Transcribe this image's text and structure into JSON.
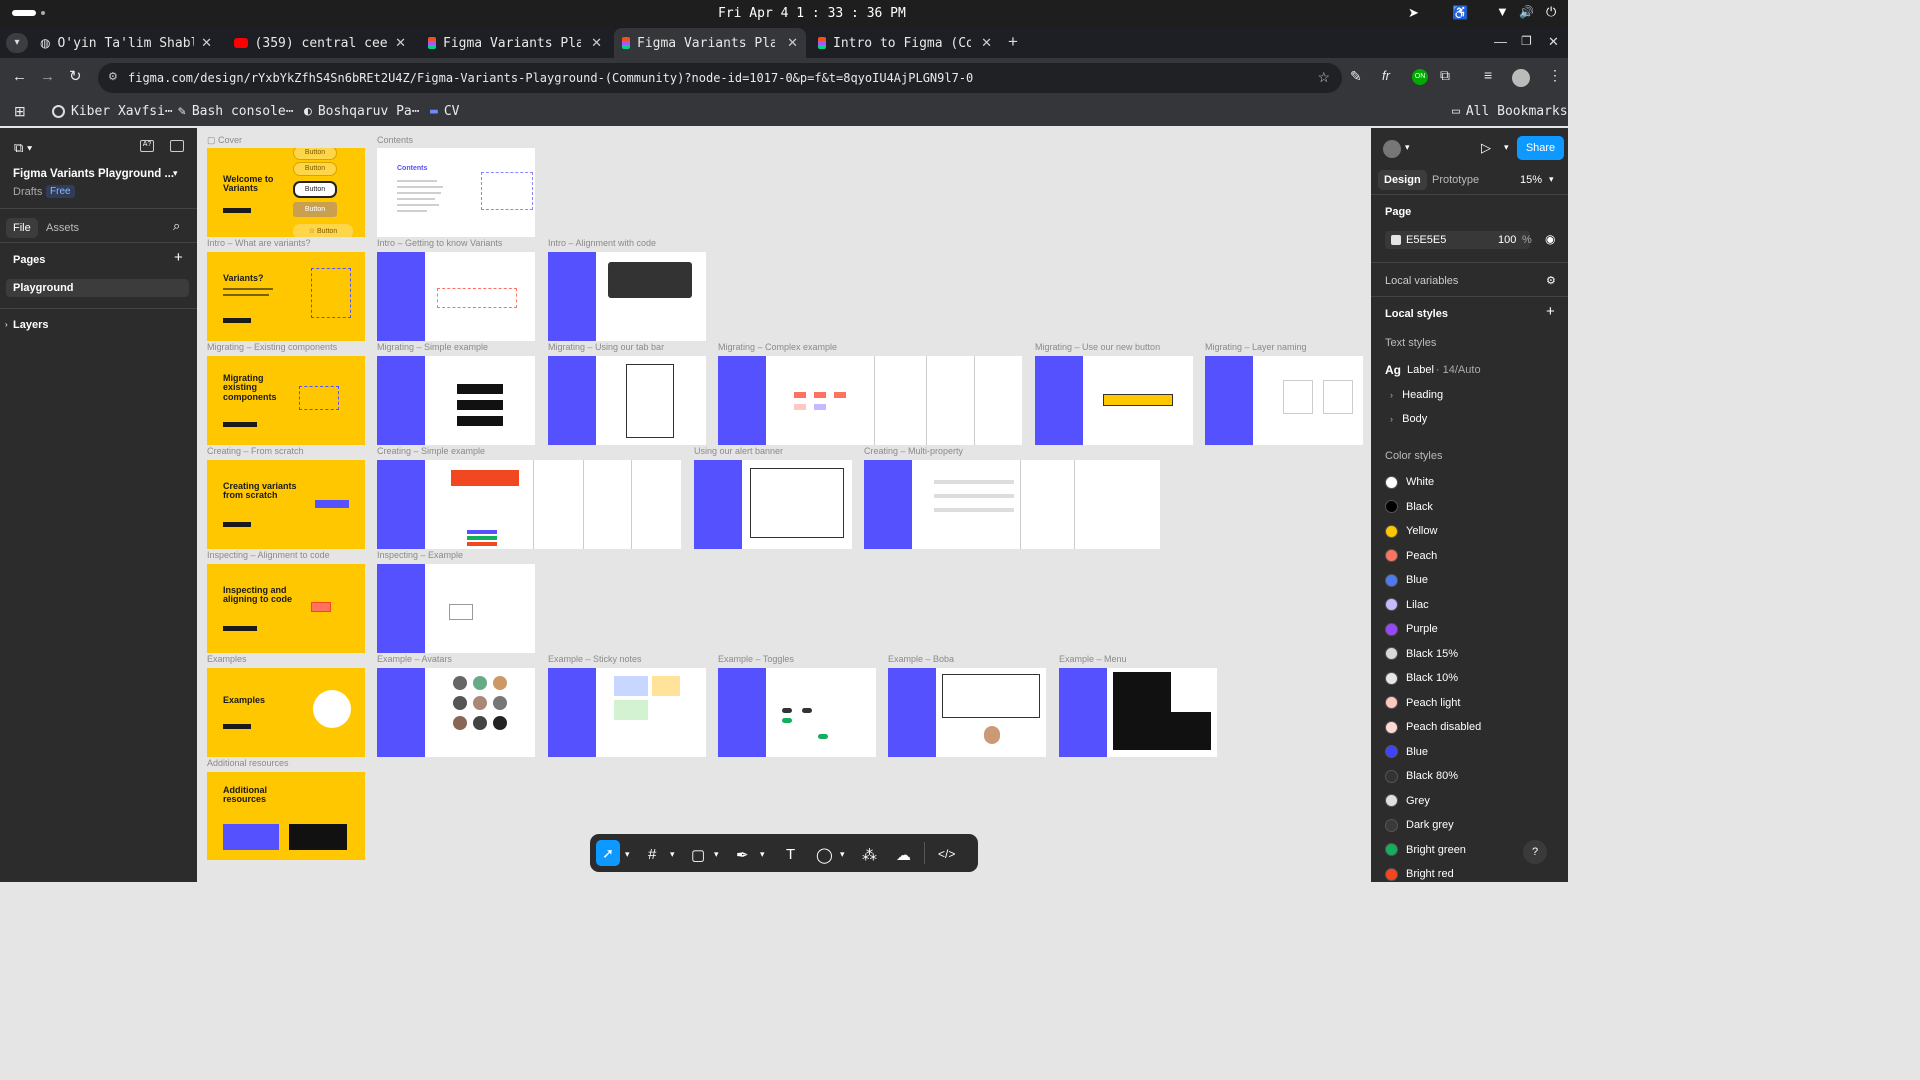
{
  "os": {
    "clock": "Fri Apr 4  1 : 33 : 36 PM"
  },
  "tabs": [
    {
      "label": "O'yin Ta'lim Shablon",
      "icon": "globe-icon"
    },
    {
      "label": "(359) central cee - Y",
      "icon": "youtube-icon"
    },
    {
      "label": "Figma Variants Playgr",
      "icon": "figma-icon"
    },
    {
      "label": "Figma Variants Playgr",
      "icon": "figma-icon"
    },
    {
      "label": "Intro to Figma (Comm",
      "icon": "figma-icon"
    }
  ],
  "address": {
    "url": "figma.com/design/rYxbYkZfhS4Sn6bREt2U4Z/Figma-Variants-Playground-(Community)?node-id=1017-0&p=f&t=8qyoIU4AjPLGN9l7-0"
  },
  "bookmarks": [
    "Kiber Xavfsi⋯",
    "Bash console⋯",
    "Boshqaruv Pa⋯",
    "CV"
  ],
  "all_bookmarks": "All Bookmarks",
  "left": {
    "file_title": "Figma Variants Playground ...",
    "drafts": "Drafts",
    "plan": "Free",
    "tab_file": "File",
    "tab_assets": "Assets",
    "pages_title": "Pages",
    "page_item": "Playground",
    "layers_title": "Layers"
  },
  "right": {
    "share": "Share",
    "tab_design": "Design",
    "tab_prototype": "Prototype",
    "zoom": "15%",
    "page_title": "Page",
    "bg_hex": "E5E5E5",
    "bg_opacity": "100",
    "pct": "%",
    "local_variables": "Local variables",
    "local_styles": "Local styles",
    "text_styles": "Text styles",
    "text_label": "Label",
    "text_label_meta": "· 14/Auto",
    "text_heading": "Heading",
    "text_body": "Body",
    "color_styles": "Color styles",
    "help": "?"
  },
  "colors": [
    {
      "name": "White",
      "hex": "#ffffff"
    },
    {
      "name": "Black",
      "hex": "#000000"
    },
    {
      "name": "Yellow",
      "hex": "#ffc700"
    },
    {
      "name": "Peach",
      "hex": "#ff7262"
    },
    {
      "name": "Blue",
      "hex": "#4b7bec"
    },
    {
      "name": "Lilac",
      "hex": "#c7b9ff"
    },
    {
      "name": "Purple",
      "hex": "#9747ff"
    },
    {
      "name": "Black 15%",
      "hex": "#d9d9d9"
    },
    {
      "name": "Black 10%",
      "hex": "#e6e6e6"
    },
    {
      "name": "Peach light",
      "hex": "#ffc7c2"
    },
    {
      "name": "Peach disabled",
      "hex": "#ffd9d5"
    },
    {
      "name": "Blue",
      "hex": "#4340ff"
    },
    {
      "name": "Black 80%",
      "hex": "#333333"
    },
    {
      "name": "Grey",
      "hex": "#e0e0e0"
    },
    {
      "name": "Dark grey",
      "hex": "#3a3a3a"
    },
    {
      "name": "Bright green",
      "hex": "#14ae5c"
    },
    {
      "name": "Bright red",
      "hex": "#f24822"
    }
  ],
  "sections": {
    "cover": "Cover",
    "contents": "Contents",
    "r1a": "Intro – What are variants?",
    "r1b": "Intro – Getting to know Variants",
    "r1c": "Intro – Alignment with code",
    "r2a": "Migrating – Existing components",
    "r2b": "Migrating – Simple example",
    "r2c": "Migrating – Using our tab bar",
    "r2d": "Migrating – Complex example",
    "r2e": "Migrating – Use our new button",
    "r2f": "Migrating – Layer naming",
    "r3a": "Creating – From scratch",
    "r3b": "Creating – Simple example",
    "r3c": "Using our alert banner",
    "r3d": "Creating – Multi-property",
    "r4a": "Inspecting – Alignment to code",
    "r4b": "Inspecting – Example",
    "r5a": "Examples",
    "r5b": "Example – Avatars",
    "r5c": "Example – Sticky notes",
    "r5d": "Example – Toggles",
    "r5e": "Example – Boba",
    "r5f": "Example – Menu",
    "r6a": "Additional resources"
  },
  "frames": {
    "cover_title": "Welcome to Variants",
    "cover_btn": "Button",
    "contents_title": "Contents",
    "intro_title": "Variants?",
    "migrate_title": "Migrating existing components",
    "create_title": "Creating variants from scratch",
    "inspect_title": "Inspecting and aligning to code",
    "examples_title": "Examples",
    "resources_title": "Additional resources"
  }
}
